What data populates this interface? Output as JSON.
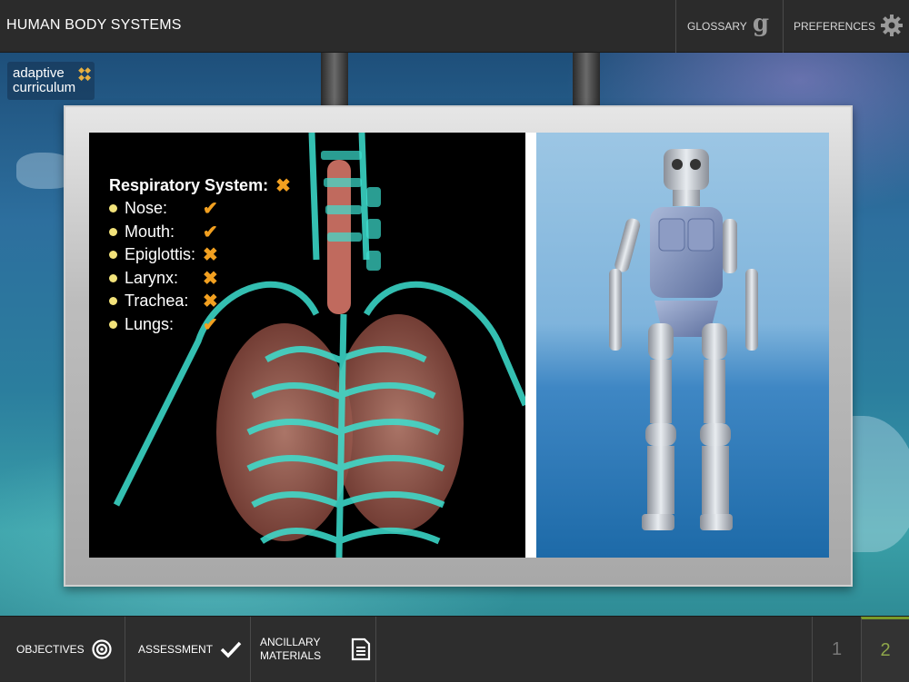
{
  "header": {
    "title": "HUMAN BODY SYSTEMS",
    "glossary_label": "GLOSSARY",
    "glossary_glyph": "g",
    "preferences_label": "PREFERENCES"
  },
  "logo": {
    "line1": "adaptive",
    "line2": "curriculum"
  },
  "video": {
    "overlay_title": "Respiratory System:",
    "overlay_title_status": "✖",
    "checklist": [
      {
        "label": "Nose:",
        "status": "✔"
      },
      {
        "label": "Mouth:",
        "status": "✔"
      },
      {
        "label": "Epiglottis:",
        "status": "✖"
      },
      {
        "label": "Larynx:",
        "status": "✖"
      },
      {
        "label": "Trachea:",
        "status": "✖"
      },
      {
        "label": "Lungs:",
        "status": "✔"
      }
    ]
  },
  "footer": {
    "objectives_label": "OBJECTIVES",
    "assessment_label": "ASSESSMENT",
    "ancillary_label_1": "ANCILLARY",
    "ancillary_label_2": "MATERIALS",
    "pages": [
      "1",
      "2"
    ],
    "current_page": "2"
  },
  "colors": {
    "bar_bg": "#2b2b2b",
    "check_orange": "#f2a020",
    "active_page_green": "#8ea64a"
  }
}
